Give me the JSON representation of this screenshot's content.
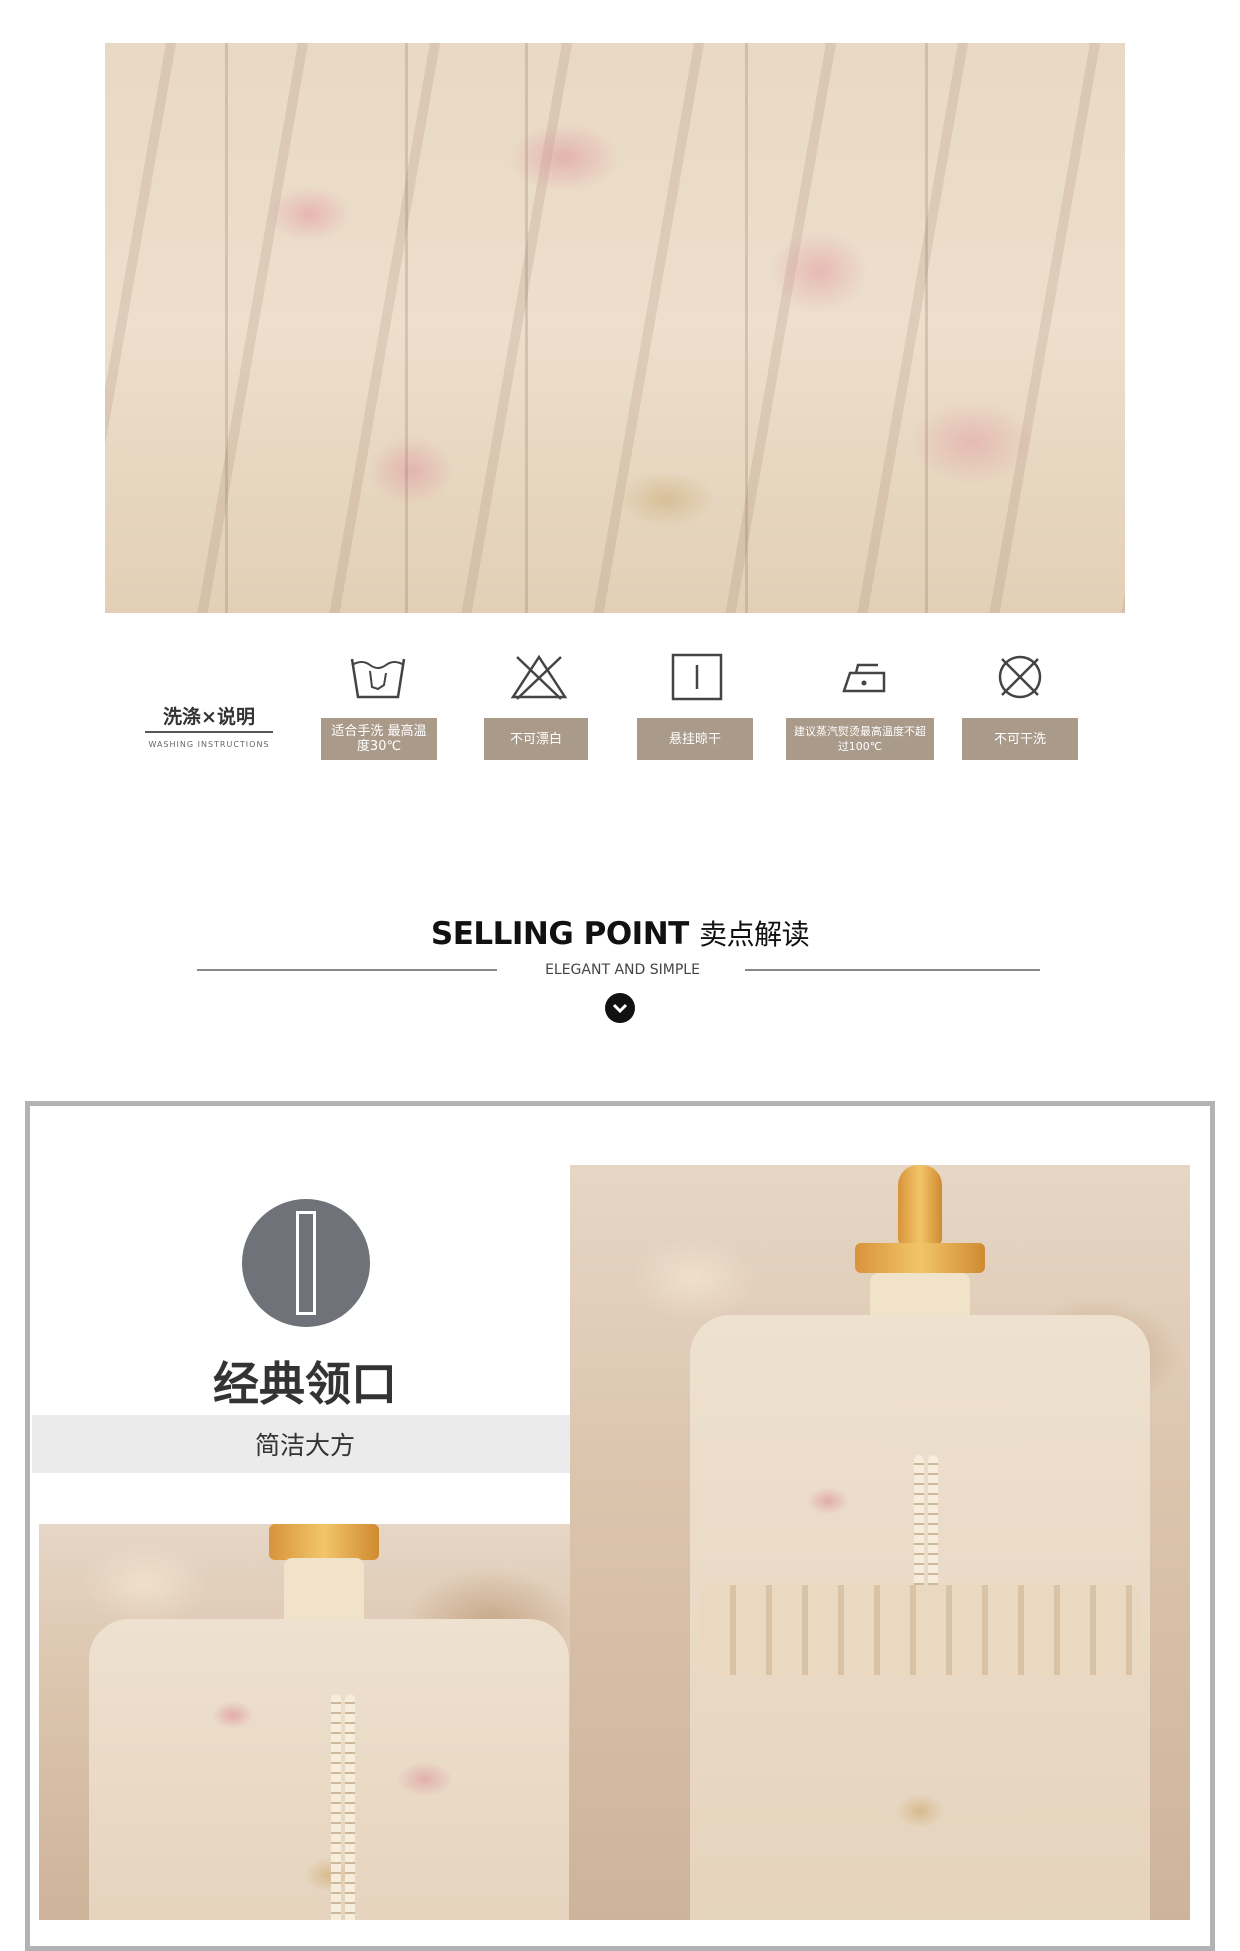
{
  "wash": {
    "title": "洗涤×说明",
    "subtitle": "WASHING INSTRUCTIONS",
    "items": [
      {
        "icon": "hand-wash-icon",
        "label": "适合手洗 最高温度30℃"
      },
      {
        "icon": "no-bleach-icon",
        "label": "不可漂白"
      },
      {
        "icon": "hang-dry-icon",
        "label": "悬挂晾干"
      },
      {
        "icon": "iron-icon",
        "label": "建议蒸汽熨烫最高温度不超过100℃"
      },
      {
        "icon": "no-dry-clean-icon",
        "label": "不可干洗"
      }
    ]
  },
  "selling": {
    "title_en": "SELLING POINT",
    "title_cn": "卖点解读",
    "subtitle": "ELEGANT AND SIMPLE"
  },
  "feature": {
    "title": "经典领口",
    "subtitle": "简洁大方"
  },
  "colors": {
    "label_bg": "#aa9a8a",
    "badge": "#6f7379",
    "frame": "#b3b3b6"
  }
}
